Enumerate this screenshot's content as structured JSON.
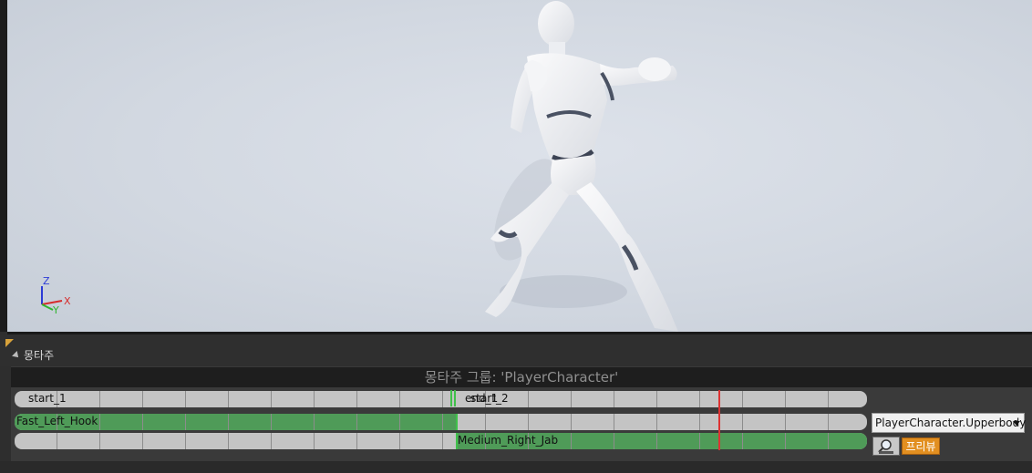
{
  "viewport": {
    "axis": {
      "z_label": "Z",
      "x_label": "X",
      "y_label": "Y"
    }
  },
  "montage_panel": {
    "tab_title": "몽타주",
    "group_label": "몽타주 그룹: 'PlayerCharacter'",
    "sections": [
      {
        "label": "start_1"
      },
      {
        "label": "end_1"
      },
      {
        "label": "start_2"
      }
    ],
    "slot_tracks": [
      {
        "anim": "Fast_Left_Hook"
      },
      {
        "anim": "Medium_Right_Jab"
      }
    ],
    "slot_name": "PlayerCharacter.Upperbody",
    "preview_label": "프리뷰"
  },
  "colors": {
    "track_green": "#4f9b58",
    "playhead_red": "#d33333",
    "preview_orange": "#e28f20"
  },
  "icons": [
    "dropdown-arrow-icon",
    "magnifier-icon",
    "collapse-triangle-icon"
  ]
}
